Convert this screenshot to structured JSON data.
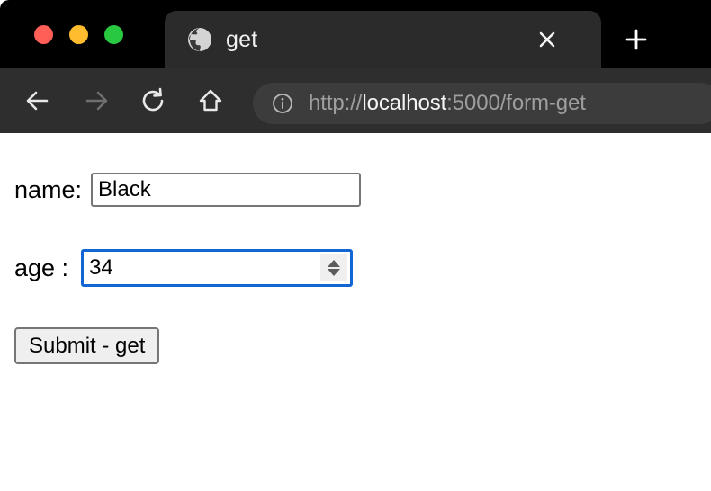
{
  "window": {
    "traffic_lights": [
      {
        "name": "close",
        "color": "#FF5F57"
      },
      {
        "name": "minimize",
        "color": "#FEBC2E"
      },
      {
        "name": "maximize",
        "color": "#28C840"
      }
    ]
  },
  "tab": {
    "title": "get",
    "favicon": "globe-icon",
    "close_label": "×"
  },
  "new_tab": {
    "label": "+"
  },
  "toolbar": {
    "back": "back-arrow-icon",
    "forward": "forward-arrow-icon",
    "reload": "reload-icon",
    "home": "home-icon",
    "colors": {
      "active": "#e8e8e8",
      "disabled": "#6f6f6f"
    }
  },
  "address_bar": {
    "security_icon": "info-circle-icon",
    "scheme": "http://",
    "host": "localhost",
    "rest": ":5000/form-get",
    "full_url": "http://localhost:5000/form-get"
  },
  "page": {
    "form": {
      "fields": [
        {
          "label": "name:",
          "type": "text",
          "value": "Black",
          "placeholder": "",
          "focused": false
        },
        {
          "label": "age :",
          "type": "number",
          "value": "34",
          "placeholder": "",
          "focused": true,
          "focus_color": "#1266d4"
        }
      ],
      "submit_label": "Submit - get"
    }
  }
}
